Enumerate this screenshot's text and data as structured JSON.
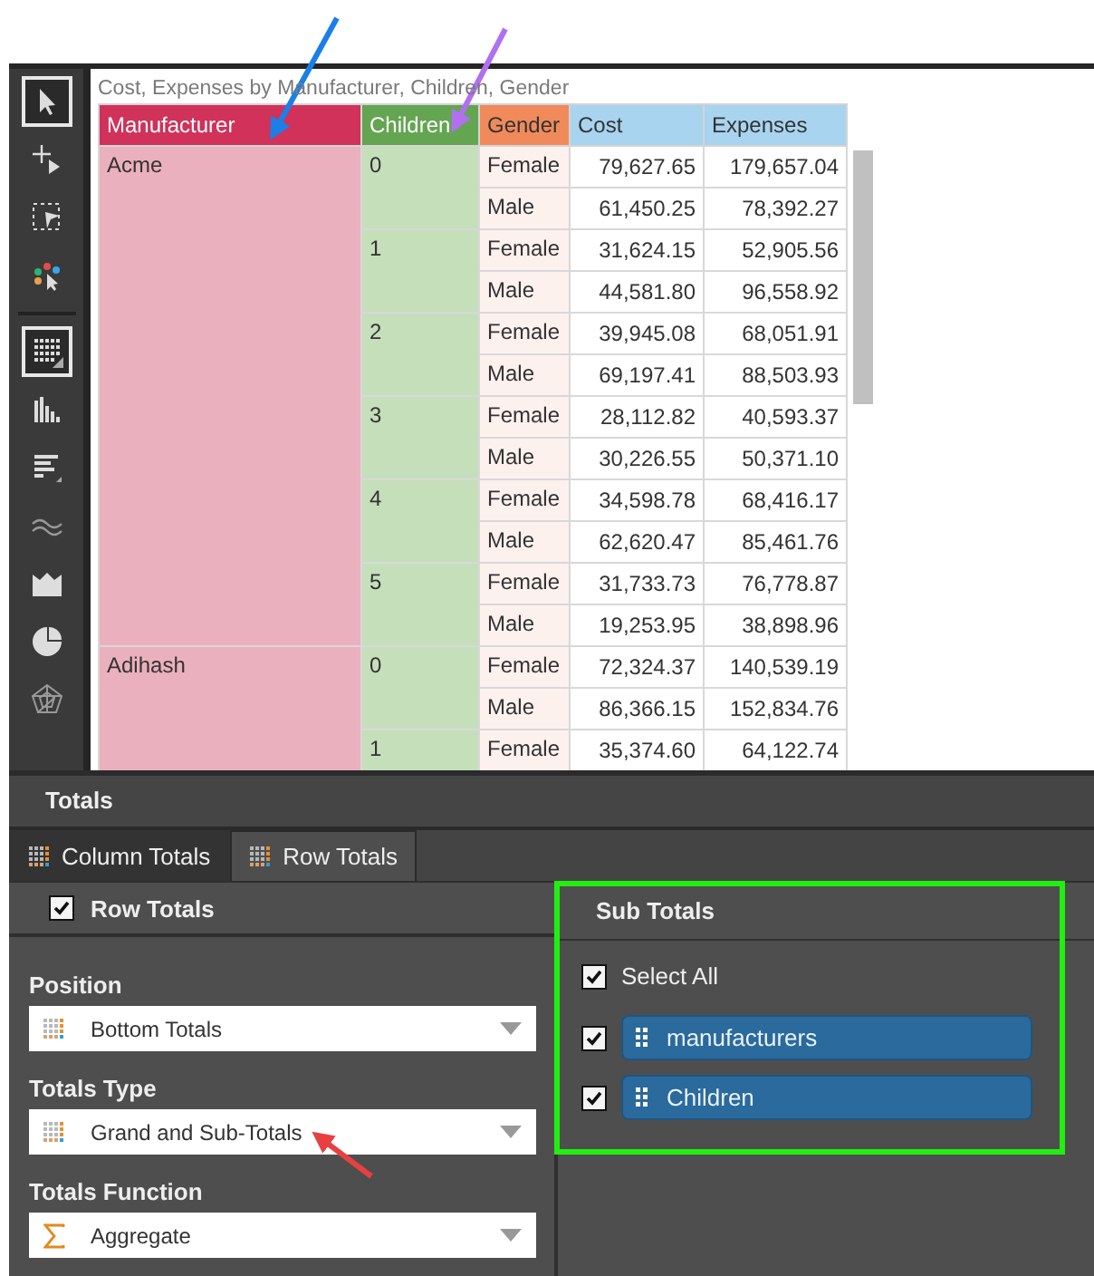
{
  "toolbar": {
    "groups": [
      {
        "tools": [
          {
            "kind": "pointer",
            "selected": true
          },
          {
            "kind": "add-pointer",
            "selected": false
          },
          {
            "kind": "marquee",
            "selected": false
          },
          {
            "kind": "color-pointer",
            "selected": false
          }
        ]
      },
      {
        "tools": [
          {
            "kind": "grid",
            "selected": true
          },
          {
            "kind": "column-chart",
            "selected": false
          },
          {
            "kind": "bar-chart",
            "selected": false
          },
          {
            "kind": "line-chart",
            "selected": false
          },
          {
            "kind": "area-chart",
            "selected": false
          },
          {
            "kind": "pie-chart",
            "selected": false
          },
          {
            "kind": "radar-chart",
            "selected": false
          }
        ]
      }
    ]
  },
  "table": {
    "title": "Cost, Expenses by Manufacturer, Children, Gender",
    "columns": [
      {
        "label": "Manufacturer",
        "color": "#d0325a"
      },
      {
        "label": "Children",
        "color": "#64a552"
      },
      {
        "label": "Gender",
        "color": "#f08a5a"
      },
      {
        "label": "Cost",
        "color": "#a8d4f0"
      },
      {
        "label": "Expenses",
        "color": "#a8d4f0"
      }
    ],
    "manufacturers": [
      {
        "name": "Acme",
        "children": [
          {
            "value": "0",
            "rows": [
              {
                "gender": "Female",
                "cost": "79,627.65",
                "expenses": "179,657.04"
              },
              {
                "gender": "Male",
                "cost": "61,450.25",
                "expenses": "78,392.27"
              }
            ]
          },
          {
            "value": "1",
            "rows": [
              {
                "gender": "Female",
                "cost": "31,624.15",
                "expenses": "52,905.56"
              },
              {
                "gender": "Male",
                "cost": "44,581.80",
                "expenses": "96,558.92"
              }
            ]
          },
          {
            "value": "2",
            "rows": [
              {
                "gender": "Female",
                "cost": "39,945.08",
                "expenses": "68,051.91"
              },
              {
                "gender": "Male",
                "cost": "69,197.41",
                "expenses": "88,503.93"
              }
            ]
          },
          {
            "value": "3",
            "rows": [
              {
                "gender": "Female",
                "cost": "28,112.82",
                "expenses": "40,593.37"
              },
              {
                "gender": "Male",
                "cost": "30,226.55",
                "expenses": "50,371.10"
              }
            ]
          },
          {
            "value": "4",
            "rows": [
              {
                "gender": "Female",
                "cost": "34,598.78",
                "expenses": "68,416.17"
              },
              {
                "gender": "Male",
                "cost": "62,620.47",
                "expenses": "85,461.76"
              }
            ]
          },
          {
            "value": "5",
            "rows": [
              {
                "gender": "Female",
                "cost": "31,733.73",
                "expenses": "76,778.87"
              },
              {
                "gender": "Male",
                "cost": "19,253.95",
                "expenses": "38,898.96"
              }
            ]
          }
        ]
      },
      {
        "name": "Adihash",
        "children": [
          {
            "value": "0",
            "rows": [
              {
                "gender": "Female",
                "cost": "72,324.37",
                "expenses": "140,539.19"
              },
              {
                "gender": "Male",
                "cost": "86,366.15",
                "expenses": "152,834.76"
              }
            ]
          },
          {
            "value": "1",
            "rows": [
              {
                "gender": "Female",
                "cost": "35,374.60",
                "expenses": "64,122.74"
              }
            ]
          }
        ]
      }
    ]
  },
  "panel": {
    "title": "Totals",
    "tabs": [
      {
        "label": "Column Totals",
        "selected": false
      },
      {
        "label": "Row Totals",
        "selected": true
      }
    ],
    "row_totals": {
      "label": "Row Totals",
      "checked": true
    },
    "fields": [
      {
        "label": "Position",
        "value": "Bottom Totals",
        "kind": "grid"
      },
      {
        "label": "Totals Type",
        "value": "Grand and Sub-Totals",
        "kind": "grid"
      },
      {
        "label": "Totals Function",
        "value": "Aggregate",
        "kind": "sigma"
      }
    ],
    "sub_totals": {
      "title": "Sub Totals",
      "select_all": {
        "label": "Select All",
        "checked": true
      },
      "items": [
        {
          "label": "manufacturers",
          "checked": true
        },
        {
          "label": "Children",
          "checked": true
        }
      ]
    }
  },
  "annotations": {
    "arrows": [
      {
        "color": "#1a7fe8"
      },
      {
        "color": "#b070f0"
      },
      {
        "color": "#e84040"
      }
    ],
    "highlight": {
      "color": "#22ee11"
    }
  }
}
